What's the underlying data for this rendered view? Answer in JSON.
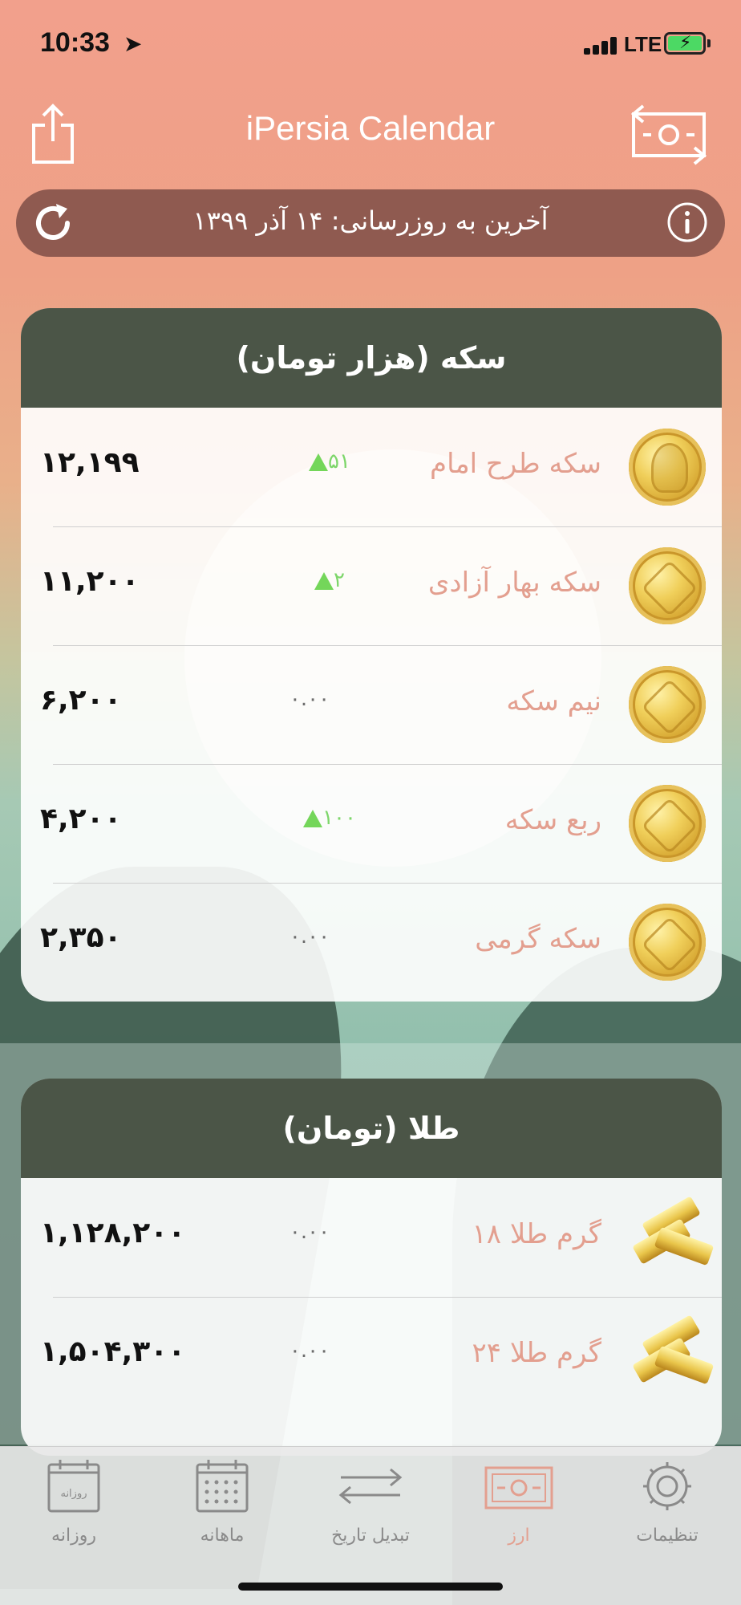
{
  "status_bar": {
    "time": "10:33",
    "network": "LTE"
  },
  "nav": {
    "title": "iPersia Calendar"
  },
  "update_bar": {
    "text": "آخرین به روزرسانی: ۱۴ آذر ۱۳۹۹"
  },
  "coins_card": {
    "title": "سکه (هزار تومان)",
    "rows": [
      {
        "name": "سکه طرح امام",
        "change": "۵۱",
        "direction": "up",
        "price": "۱۲,۱۹۹",
        "icon": "coin-portrait-icon"
      },
      {
        "name": "سکه بهار آزادی",
        "change": "۲",
        "direction": "up",
        "price": "۱۱,۲۰۰",
        "icon": "coin-icon"
      },
      {
        "name": "نیم سکه",
        "change": "۰.۰۰",
        "direction": "none",
        "price": "۶,۲۰۰",
        "icon": "coin-icon"
      },
      {
        "name": "ربع سکه",
        "change": "۱۰۰",
        "direction": "up",
        "price": "۴,۲۰۰",
        "icon": "coin-icon"
      },
      {
        "name": "سکه گرمی",
        "change": "۰.۰۰",
        "direction": "none",
        "price": "۲,۳۵۰",
        "icon": "coin-icon"
      }
    ]
  },
  "gold_card": {
    "title": "طلا (تومان)",
    "rows": [
      {
        "name": "گرم طلا ۱۸",
        "change": "۰.۰۰",
        "direction": "none",
        "price": "۱,۱۲۸,۲۰۰",
        "icon": "gold-bars-icon"
      },
      {
        "name": "گرم طلا ۲۴",
        "change": "۰.۰۰",
        "direction": "none",
        "price": "۱,۵۰۴,۳۰۰",
        "icon": "gold-bars-icon"
      }
    ]
  },
  "tabs": [
    {
      "label": "روزانه",
      "icon": "daily-calendar-icon",
      "icon_text": "روزانه",
      "active": false
    },
    {
      "label": "ماهانه",
      "icon": "monthly-calendar-icon",
      "active": false
    },
    {
      "label": "تبدیل تاریخ",
      "icon": "convert-arrows-icon",
      "active": false
    },
    {
      "label": "ارز",
      "icon": "currency-icon",
      "active": true
    },
    {
      "label": "تنظیمات",
      "icon": "gear-icon",
      "active": false
    }
  ],
  "colors": {
    "header_bg": "#f2a08c",
    "update_bar_bg": "#8f5a50",
    "card_header_bg": "#4b5547",
    "item_name": "#e39f8f",
    "change_up": "#7dd66a",
    "active_tab": "#e39f8f"
  }
}
